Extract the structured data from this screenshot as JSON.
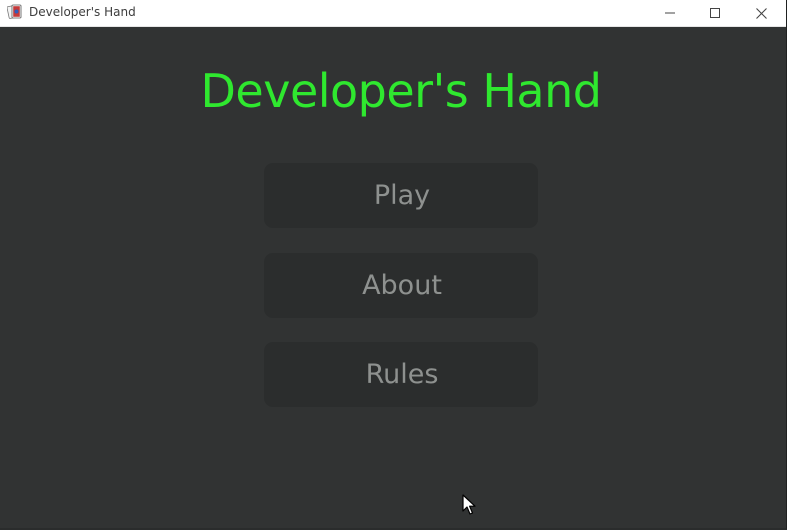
{
  "window": {
    "title": "Developer's Hand",
    "icon": "playing-cards-icon",
    "controls": {
      "minimize": "minimize-icon",
      "maximize": "maximize-icon",
      "close": "close-icon"
    }
  },
  "main": {
    "title": "Developer's Hand",
    "title_color": "#2fe82f",
    "background_color": "#313333",
    "menu": [
      {
        "label": "Play"
      },
      {
        "label": "About"
      },
      {
        "label": "Rules"
      }
    ]
  }
}
